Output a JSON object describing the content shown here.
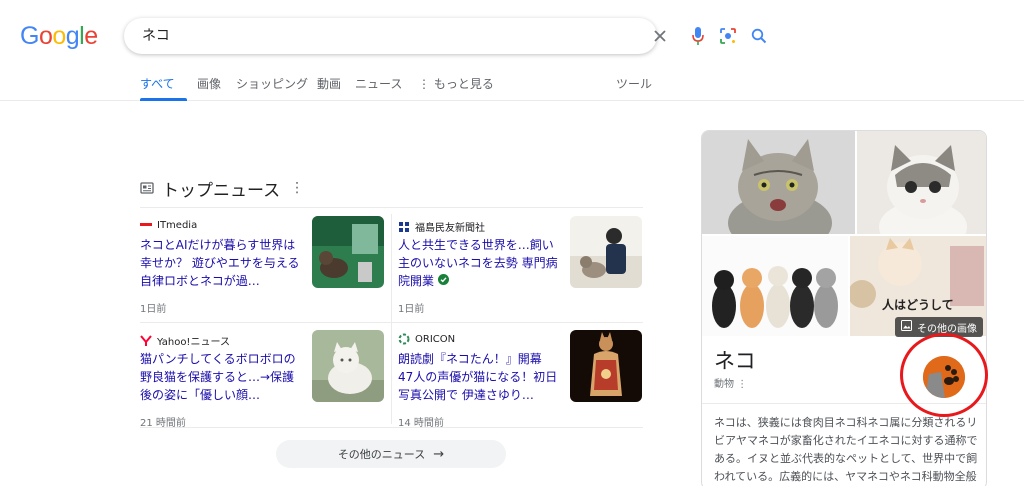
{
  "logo": {
    "text": [
      "G",
      "o",
      "o",
      "g",
      "l",
      "e"
    ],
    "colors": [
      "#4285f4",
      "#ea4335",
      "#fbbc05",
      "#4285f4",
      "#34a853",
      "#ea4335"
    ]
  },
  "search": {
    "query": "ネコ"
  },
  "tabs": [
    {
      "label": "すべて",
      "active": true
    },
    {
      "label": "画像"
    },
    {
      "label": "ショッピング"
    },
    {
      "label": "動画"
    },
    {
      "label": "ニュース"
    },
    {
      "label": "⋮ もっと見る"
    }
  ],
  "tools_label": "ツール",
  "top_news": {
    "title": "トップニュース",
    "items": [
      {
        "source": "ITmedia",
        "headline": "ネコとAIだけが暮らす世界は幸せか？ 遊びやエサを与える自律ロボとネコが過…",
        "time": "1日前"
      },
      {
        "source": "福島民友新聞社",
        "headline": "人と共生できる世界を…飼い主のいないネコを去勢 専門病院開業",
        "time": "1日前"
      },
      {
        "source": "Yahoo!ニュース",
        "headline": "猫パンチしてくるボロボロの野良猫を保護すると…→保護後の姿に「優しい顔…",
        "time": "21 時間前"
      },
      {
        "source": "ORICON",
        "headline": "朗読劇『ネコたん！』開幕 47人の声優が猫になる！初日写真公開で 伊達さゆり…",
        "time": "14 時間前"
      }
    ],
    "more_label": "その他のニュース"
  },
  "knowledge_panel": {
    "more_images_label": "その他の画像",
    "image_caption": "人はどうして",
    "title": "ネコ",
    "subtitle": "動物 ⋮",
    "description": "ネコは、狭義には食肉目ネコ科ネコ属に分類されるリビアヤマネコが家畜化されたイエネコに対する通称である。イヌと並ぶ代表的なペットとして、世界中で飼われている。広義的には、ヤマネコやネコ科動物全般"
  },
  "colors": {
    "link": "#1a0dab",
    "accent": "#1a73e8",
    "highlight": "#e8191c"
  }
}
